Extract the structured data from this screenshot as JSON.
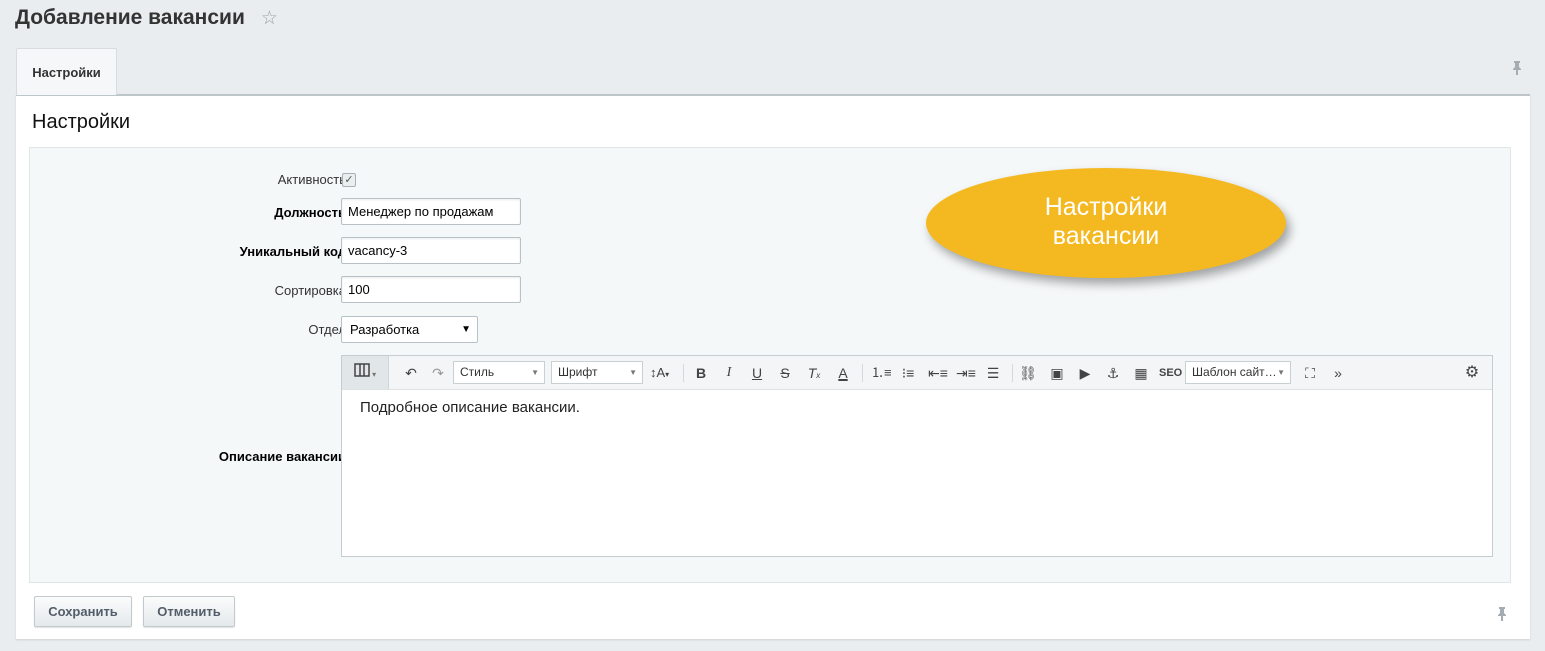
{
  "header": {
    "title": "Добавление вакансии",
    "star_icon": "☆"
  },
  "tabs": [
    {
      "label": "Настройки"
    }
  ],
  "panel": {
    "section_title": "Настройки"
  },
  "form": {
    "active": {
      "label": "Активность",
      "checked": true
    },
    "position": {
      "label": "Должность",
      "value": "Менеджер по продажам"
    },
    "code": {
      "label": "Уникальный код",
      "value": "vacancy-3"
    },
    "sort": {
      "label": "Сортировка",
      "value": "100"
    },
    "department": {
      "label": "Отдел",
      "value": "Разработка"
    },
    "description": {
      "label": "Описание вакансии",
      "text": "Подробное описание вакансии.",
      "toolbar": {
        "style_label": "Стиль",
        "font_label": "Шрифт",
        "template_label": "Шаблон сайт…",
        "seo_label": "SEO"
      }
    }
  },
  "callout": {
    "line1": "Настройки",
    "line2": "вакансии",
    "color": "#f4b921"
  },
  "buttons": {
    "save": "Сохранить",
    "cancel": "Отменить"
  }
}
